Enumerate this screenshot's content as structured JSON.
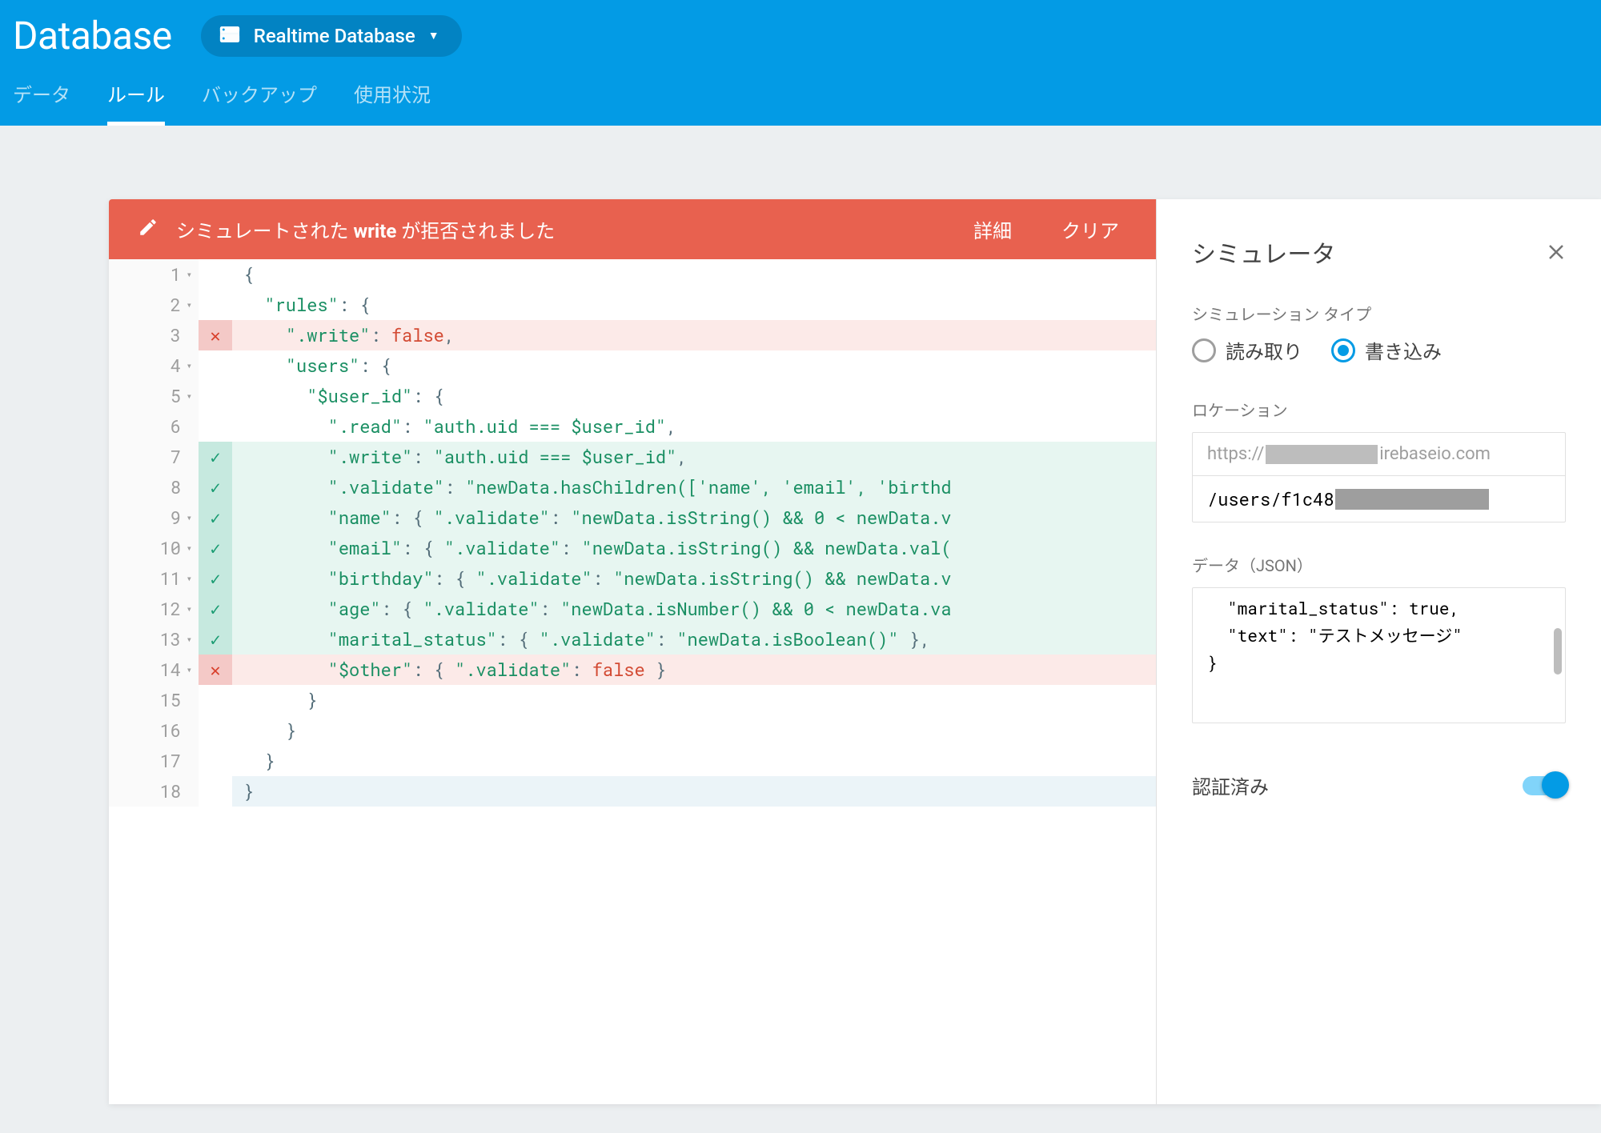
{
  "header": {
    "title": "Database",
    "selector_label": "Realtime Database"
  },
  "tabs": [
    {
      "label": "データ",
      "active": false
    },
    {
      "label": "ルール",
      "active": true
    },
    {
      "label": "バックアップ",
      "active": false
    },
    {
      "label": "使用状況",
      "active": false
    }
  ],
  "alert": {
    "prefix": "シミュレートされた ",
    "bold": "write",
    "suffix": " が拒否されました",
    "detail": "詳細",
    "clear": "クリア"
  },
  "code": {
    "lines": [
      {
        "n": 1,
        "fold": true,
        "marker": "",
        "hl": "",
        "text": "{"
      },
      {
        "n": 2,
        "fold": true,
        "marker": "",
        "hl": "",
        "text": "  \"rules\": {"
      },
      {
        "n": 3,
        "fold": false,
        "marker": "fail",
        "hl": "fail",
        "text": "    \".write\": false,"
      },
      {
        "n": 4,
        "fold": true,
        "marker": "",
        "hl": "",
        "text": "    \"users\": {"
      },
      {
        "n": 5,
        "fold": true,
        "marker": "",
        "hl": "",
        "text": "      \"$user_id\": {"
      },
      {
        "n": 6,
        "fold": false,
        "marker": "",
        "hl": "",
        "text": "        \".read\": \"auth.uid === $user_id\","
      },
      {
        "n": 7,
        "fold": false,
        "marker": "pass",
        "hl": "pass",
        "text": "        \".write\": \"auth.uid === $user_id\","
      },
      {
        "n": 8,
        "fold": false,
        "marker": "pass",
        "hl": "pass",
        "text": "        \".validate\": \"newData.hasChildren(['name', 'email', 'birthd"
      },
      {
        "n": 9,
        "fold": true,
        "marker": "pass",
        "hl": "pass",
        "text": "        \"name\": { \".validate\": \"newData.isString() && 0 < newData.v"
      },
      {
        "n": 10,
        "fold": true,
        "marker": "pass",
        "hl": "pass",
        "text": "        \"email\": { \".validate\": \"newData.isString() && newData.val("
      },
      {
        "n": 11,
        "fold": true,
        "marker": "pass",
        "hl": "pass",
        "text": "        \"birthday\": { \".validate\": \"newData.isString() && newData.v"
      },
      {
        "n": 12,
        "fold": true,
        "marker": "pass",
        "hl": "pass",
        "text": "        \"age\": { \".validate\": \"newData.isNumber() && 0 < newData.va"
      },
      {
        "n": 13,
        "fold": true,
        "marker": "pass",
        "hl": "pass",
        "text": "        \"marital_status\": { \".validate\": \"newData.isBoolean()\" },"
      },
      {
        "n": 14,
        "fold": true,
        "marker": "fail",
        "hl": "fail",
        "text": "        \"$other\": { \".validate\": false }"
      },
      {
        "n": 15,
        "fold": false,
        "marker": "",
        "hl": "",
        "text": "      }"
      },
      {
        "n": 16,
        "fold": false,
        "marker": "",
        "hl": "",
        "text": "    }"
      },
      {
        "n": 17,
        "fold": false,
        "marker": "",
        "hl": "",
        "text": "  }"
      },
      {
        "n": 18,
        "fold": false,
        "marker": "",
        "hl": "cursor",
        "text": "}"
      }
    ]
  },
  "simulator": {
    "title": "シミュレータ",
    "type_label": "シミュレーション タイプ",
    "read_label": "読み取り",
    "write_label": "書き込み",
    "location_label": "ロケーション",
    "host_prefix": "https://",
    "host_suffix": "irebaseio.com",
    "path_prefix": "/users/f1c48",
    "json_label": "データ（JSON）",
    "json_body": "  \"marital_status\": true,\n  \"text\": \"テストメッセージ\"\n}",
    "auth_label": "認証済み",
    "auth_on": true
  }
}
